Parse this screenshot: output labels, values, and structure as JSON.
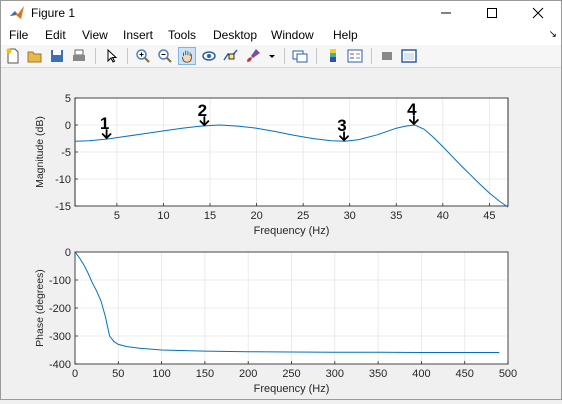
{
  "window": {
    "title": "Figure 1",
    "controls": {
      "minimize_icon": "minimize-icon",
      "maximize_icon": "maximize-icon",
      "close_icon": "close-icon"
    }
  },
  "menubar": {
    "items": [
      "File",
      "Edit",
      "View",
      "Insert",
      "Tools",
      "Desktop",
      "Window",
      "Help"
    ],
    "dock_glyph": "↘"
  },
  "toolbar": {
    "buttons": [
      {
        "icon": "new-figure-icon"
      },
      {
        "icon": "open-file-icon"
      },
      {
        "icon": "save-icon"
      },
      {
        "icon": "print-icon"
      },
      {
        "icon": "edit-plot-arrow-icon"
      },
      {
        "icon": "zoom-in-icon"
      },
      {
        "icon": "zoom-out-icon"
      },
      {
        "icon": "pan-hand-icon",
        "active": true
      },
      {
        "icon": "rotate-3d-icon"
      },
      {
        "icon": "data-cursor-icon"
      },
      {
        "icon": "brush-icon"
      },
      {
        "icon": "link-plot-icon"
      },
      {
        "icon": "insert-colorbar-icon"
      },
      {
        "icon": "insert-legend-icon"
      },
      {
        "icon": "hide-plot-tools-icon"
      },
      {
        "icon": "show-plot-tools-icon"
      }
    ]
  },
  "colors": {
    "line": "#0072bd",
    "grid": "#e6e6e6",
    "axis": "#262626"
  },
  "chart_data": [
    {
      "type": "line",
      "xlabel": "Frequency (Hz)",
      "ylabel": "Magnitude (dB)",
      "xlim": [
        0.5,
        47
      ],
      "ylim": [
        -15,
        5
      ],
      "xticks": [
        5,
        10,
        15,
        20,
        25,
        30,
        35,
        40,
        45
      ],
      "yticks": [
        5,
        0,
        -5,
        -10,
        -15
      ],
      "grid": true,
      "x": [
        0.5,
        2,
        4,
        6,
        8,
        10,
        12,
        14,
        16,
        18,
        20,
        22,
        24,
        26,
        28,
        29.5,
        31,
        33,
        35,
        36,
        37,
        38,
        39,
        40,
        41,
        42,
        43,
        44,
        45,
        46,
        47
      ],
      "y": [
        -3.0,
        -2.9,
        -2.6,
        -2.1,
        -1.6,
        -1.1,
        -0.6,
        -0.2,
        0.0,
        -0.2,
        -0.6,
        -1.2,
        -1.9,
        -2.5,
        -2.9,
        -3.0,
        -2.7,
        -1.8,
        -0.6,
        -0.2,
        0.0,
        -0.8,
        -2.3,
        -4.0,
        -5.8,
        -7.6,
        -9.3,
        -11.0,
        -12.6,
        -14.0,
        -15.2
      ],
      "annotations": [
        {
          "label": "1",
          "x": 4,
          "y": -2.6
        },
        {
          "label": "2",
          "x": 14.5,
          "y": -0.2
        },
        {
          "label": "3",
          "x": 29.5,
          "y": -3.0
        },
        {
          "label": "4",
          "x": 37,
          "y": 0.0
        }
      ]
    },
    {
      "type": "line",
      "xlabel": "Frequency (Hz)",
      "ylabel": "Phase (degrees)",
      "xlim": [
        0,
        500
      ],
      "ylim": [
        -400,
        0
      ],
      "xticks": [
        0,
        50,
        100,
        150,
        200,
        250,
        300,
        350,
        400,
        450,
        500
      ],
      "yticks": [
        0,
        -100,
        -200,
        -300,
        -400
      ],
      "grid": true,
      "x": [
        0,
        5,
        10,
        15,
        20,
        25,
        30,
        35,
        40,
        45,
        50,
        60,
        75,
        100,
        150,
        200,
        250,
        300,
        350,
        400,
        450,
        490
      ],
      "y": [
        0,
        -20,
        -45,
        -75,
        -110,
        -140,
        -175,
        -230,
        -300,
        -320,
        -330,
        -338,
        -344,
        -350,
        -354,
        -356,
        -357,
        -358,
        -358,
        -359,
        -359,
        -359
      ]
    }
  ]
}
